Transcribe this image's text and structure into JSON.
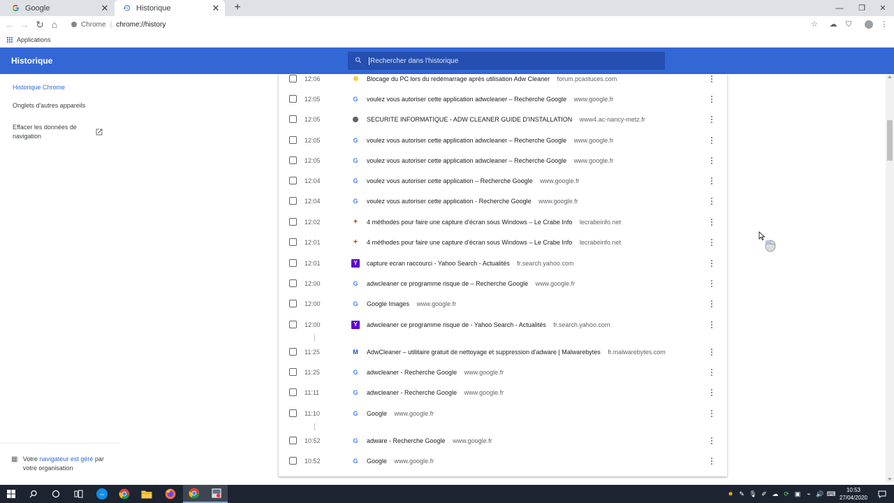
{
  "browser": {
    "tabs": [
      {
        "title": "Google",
        "icon": "google-g-icon",
        "active": false
      },
      {
        "title": "Historique",
        "icon": "history-icon",
        "active": true
      }
    ],
    "omnibox": {
      "site_label": "Chrome",
      "separator": "|",
      "url": "chrome://history"
    },
    "bookmarks_bar": {
      "apps_label": "Applications"
    }
  },
  "history_page": {
    "title": "Historique",
    "search_placeholder": "Rechercher dans l'historique",
    "sidebar": {
      "items": [
        {
          "label": "Historique Chrome",
          "active": true
        },
        {
          "label": "Onglets d'autres appareils",
          "active": false
        }
      ],
      "clear_data_label": "Effacer les données de navigation",
      "managed_prefix": "Votre",
      "managed_link": "navigateur est géré",
      "managed_suffix": "par votre organisation"
    },
    "entries": [
      {
        "time": "12:06",
        "title": "Blocage du PC lors du redémarrage après utilisation Adw Cleaner",
        "domain": "forum.pcastuces.com",
        "icon": "pcastuces-icon"
      },
      {
        "time": "12:05",
        "title": "voulez vous autoriser cette application adwcleaner – Recherche Google",
        "domain": "www.google.fr",
        "icon": "google-g-icon"
      },
      {
        "time": "12:05",
        "title": "SECURITE INFORMATIQUE - ADW CLEANER GUIDE D'INSTALLATION",
        "domain": "www4.ac-nancy-metz.fr",
        "icon": "globe-icon"
      },
      {
        "time": "12:05",
        "title": "voulez vous autoriser cette application adwcleaner – Recherche Google",
        "domain": "www.google.fr",
        "icon": "google-g-icon"
      },
      {
        "time": "12:05",
        "title": "voulez vous autoriser cette application adwcleaner – Recherche Google",
        "domain": "www.google.fr",
        "icon": "google-g-icon"
      },
      {
        "time": "12:04",
        "title": "voulez vous autoriser cette application – Recherche Google",
        "domain": "www.google.fr",
        "icon": "google-g-icon"
      },
      {
        "time": "12:04",
        "title": "voulez vous autoriser cette application - Recherche Google",
        "domain": "www.google.fr",
        "icon": "google-g-icon"
      },
      {
        "time": "12:02",
        "title": "4 méthodes pour faire une capture d'écran sous Windows – Le Crabe Info",
        "domain": "lecrabeinfo.net",
        "icon": "crabe-icon"
      },
      {
        "time": "12:01",
        "title": "4 méthodes pour faire une capture d'écran sous Windows – Le Crabe Info",
        "domain": "lecrabeinfo.net",
        "icon": "crabe-icon"
      },
      {
        "time": "12:01",
        "title": "capture ecran raccourci - Yahoo Search - Actualités",
        "domain": "fr.search.yahoo.com",
        "icon": "yahoo-icon"
      },
      {
        "time": "12:00",
        "title": "adwcleaner ce programme risque de – Recherche Google",
        "domain": "www.google.fr",
        "icon": "google-g-icon"
      },
      {
        "time": "12:00",
        "title": "Google Images",
        "domain": "www.google.fr",
        "icon": "google-g-icon"
      },
      {
        "time": "12:00",
        "title": "adwcleaner ce programme risque de - Yahoo Search - Actualités",
        "domain": "fr.search.yahoo.com",
        "icon": "yahoo-icon"
      },
      {
        "time": "11:25",
        "title": "AdwCleaner – utilitaire gratuit de nettoyage et suppression d'adware | Malwarebytes",
        "domain": "fr.malwarebytes.com",
        "icon": "malwarebytes-icon"
      },
      {
        "time": "11:25",
        "title": "adwcleaner - Recherche Google",
        "domain": "www.google.fr",
        "icon": "google-g-icon"
      },
      {
        "time": "11:11",
        "title": "adwcleaner - Recherche Google",
        "domain": "www.google.fr",
        "icon": "google-g-icon"
      },
      {
        "time": "11:10",
        "title": "Google",
        "domain": "www.google.fr",
        "icon": "google-g-icon"
      },
      {
        "time": "10:52",
        "title": "adware - Recherche Google",
        "domain": "www.google.fr",
        "icon": "google-g-icon"
      },
      {
        "time": "10:52",
        "title": "Google",
        "domain": "www.google.fr",
        "icon": "google-g-icon"
      }
    ]
  },
  "taskbar": {
    "icons": [
      "windows-start-icon",
      "search-icon",
      "cortana-icon",
      "task-view-icon",
      "teamviewer-icon",
      "chrome-icon",
      "file-explorer-icon",
      "firefox-icon",
      "chrome-active-icon",
      "screen-recorder-icon"
    ],
    "clock": {
      "time": "10:53",
      "date": "27/04/2020"
    }
  },
  "colors": {
    "header_blue": "#3367d6",
    "search_bg": "#254fb0",
    "taskbar": "#1c2431"
  }
}
